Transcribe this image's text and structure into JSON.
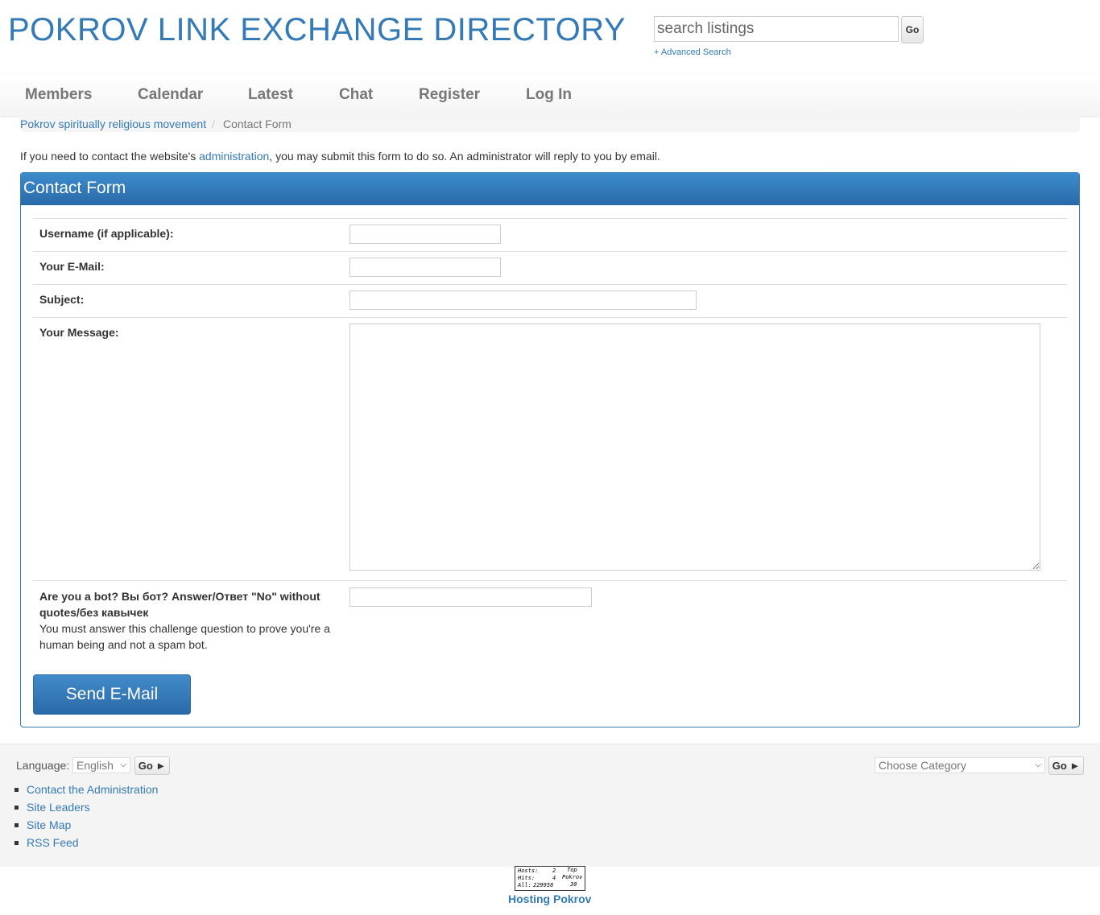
{
  "header": {
    "site_title": "POKROV LINK EXCHANGE DIRECTORY",
    "search_placeholder": "search listings",
    "search_go": "Go",
    "advanced_search": "+ Advanced Search"
  },
  "nav": {
    "items": [
      "Members",
      "Calendar",
      "Latest",
      "Chat",
      "Register",
      "Log In"
    ]
  },
  "breadcrumb": {
    "home": "Pokrov spiritually religious movement",
    "separator": "/",
    "current": "Contact Form"
  },
  "intro": {
    "before": "If you need to contact the website's ",
    "link": "administration",
    "after": ", you may submit this form to do so. An administrator will reply to you by email."
  },
  "form": {
    "title": "Contact Form",
    "username_label": "Username (if applicable):",
    "email_label": "Your E-Mail:",
    "subject_label": "Subject:",
    "message_label": "Your Message:",
    "bot_label": "Are you a bot? Вы бот? Answer/Ответ \"No\" without quotes/без кавычек",
    "bot_help": "You must answer this challenge question to prove you're a human being and not a spam bot.",
    "submit": "Send E-Mail"
  },
  "footer": {
    "language_label": "Language:",
    "language_value": "English",
    "language_go": "Go ►",
    "category_value": "Choose Category",
    "category_go": "Go ►",
    "links": [
      "Contact the Administration",
      "Site Leaders",
      "Site Map",
      "RSS Feed"
    ],
    "counter": {
      "hosts_label": "Hosts:",
      "hosts_value": "2",
      "hits_label": "Hits:",
      "hits_value": "4",
      "all_label": "All:",
      "all_value": "229958",
      "top_label": "Top",
      "site_label": "Pokrov",
      "rank_value": "30"
    },
    "hosting": "Hosting Pokrov"
  },
  "colors": {
    "accent": "#337ab7",
    "panel_header": "#2a6aa8",
    "footer_bg": "#f4f4f4"
  }
}
